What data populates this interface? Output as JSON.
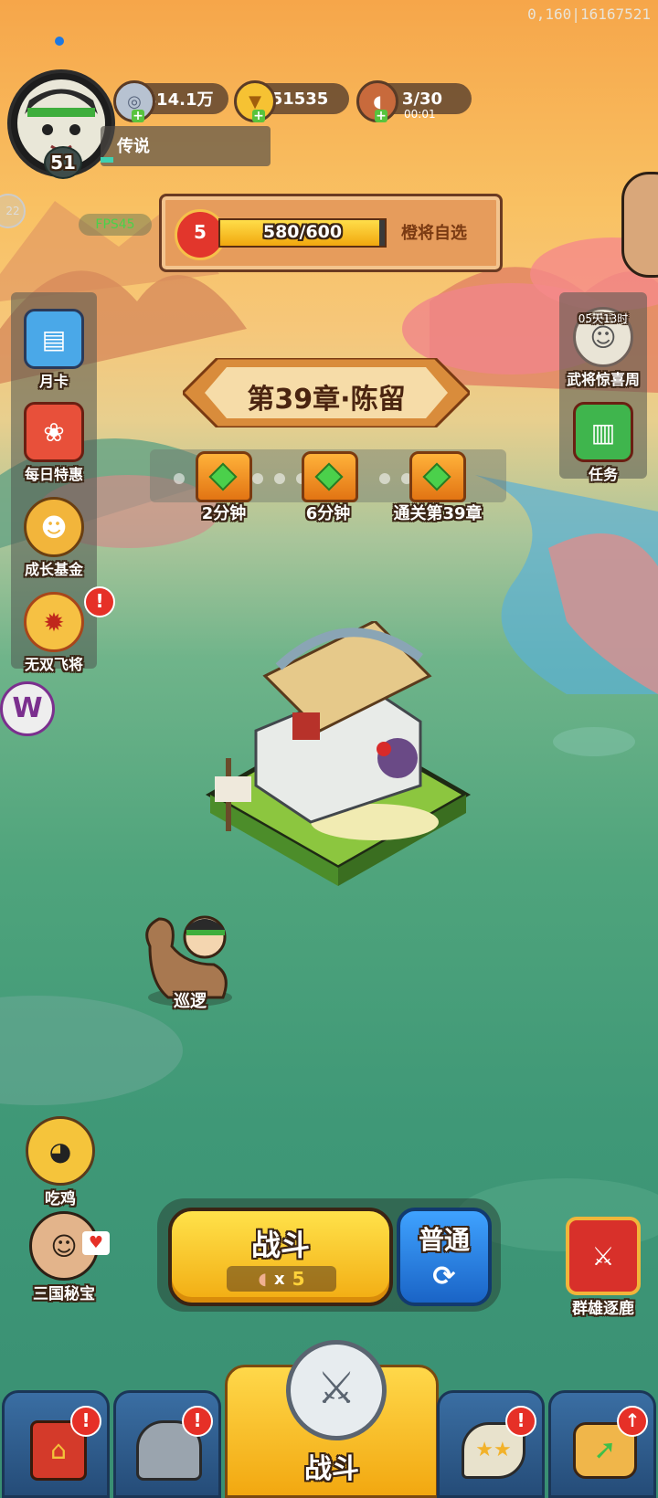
{
  "debug_text": "0,160|16167521",
  "player": {
    "level": "51",
    "title": "传说"
  },
  "currencies": {
    "silver": "414.1万",
    "gold": "51535",
    "stamina": "3/30",
    "stamina_timer": "00:01"
  },
  "fps": "FPS45",
  "side_badge_left": "22",
  "quest_bar": {
    "stars": "5",
    "progress_text": "580/600",
    "progress_fraction": 0.967,
    "action": "橙将自选"
  },
  "chapter": {
    "title": "第39章·陈留"
  },
  "rewards": [
    {
      "label": "2分钟"
    },
    {
      "label": "6分钟"
    },
    {
      "label": "通关第39章"
    }
  ],
  "left_menu": [
    {
      "label": "月卡",
      "icon": "month-card-icon"
    },
    {
      "label": "每日特惠",
      "icon": "gift-bag-icon"
    },
    {
      "label": "成长基金",
      "icon": "growth-fund-icon"
    },
    {
      "label": "无双飞将",
      "icon": "lucky-wheel-icon"
    }
  ],
  "right_menu": [
    {
      "label": "武将惊喜周",
      "timer": "05天13时",
      "icon": "general-portrait-icon"
    },
    {
      "label": "任务",
      "icon": "scroll-icon"
    }
  ],
  "patrol_label": "巡逻",
  "left_bottom": [
    {
      "label": "吃鸡",
      "icon": "chicken-icon"
    },
    {
      "label": "三国秘宝",
      "icon": "treasure-icon"
    }
  ],
  "battle": {
    "button_label": "战斗",
    "cost_multiplier": "x",
    "cost_value": "5",
    "mode_label": "普通",
    "mode_icon": "refresh-icon"
  },
  "right_bottom": {
    "label": "群雄逐鹿",
    "icon": "banner-icon"
  },
  "bottom_nav": {
    "center_label": "战斗",
    "tabs": [
      "shop-tab",
      "equipment-tab",
      "battle-tab",
      "heroes-tab",
      "upgrade-tab"
    ]
  },
  "colors": {
    "accent_yellow": "#ffd23a",
    "battle_button": "#f7c417",
    "mode_button": "#1e7de0",
    "badge_red": "#e63027"
  }
}
